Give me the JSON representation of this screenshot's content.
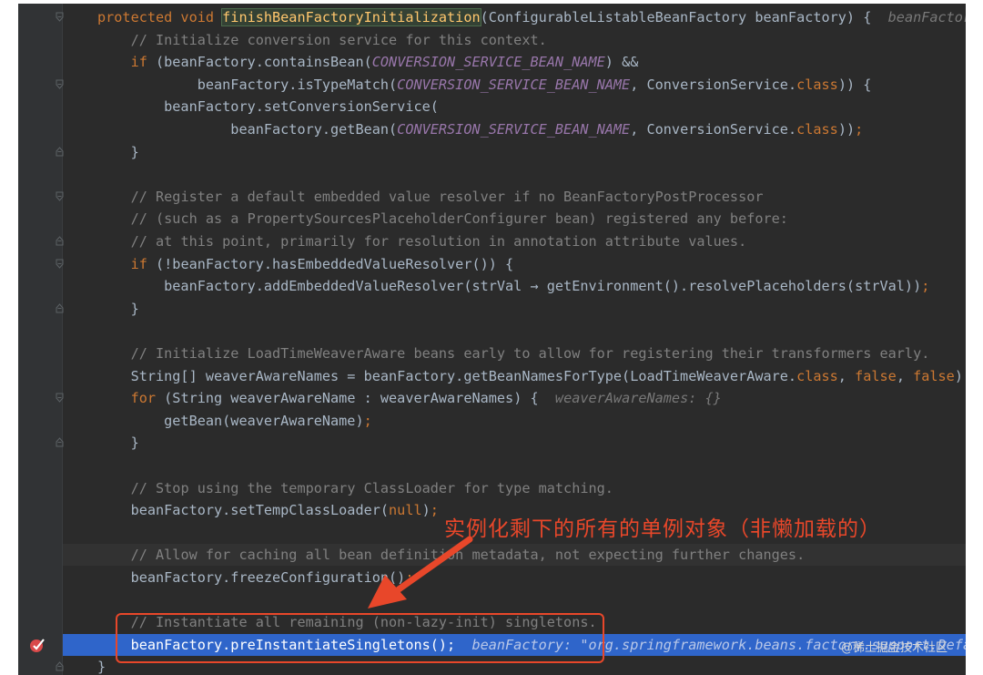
{
  "editor": {
    "lines": [
      {
        "id": "l1",
        "fold": "open",
        "tokens": [
          {
            "t": "protected void ",
            "c": "kw"
          },
          {
            "t": "finishBeanFactoryInitialization",
            "c": "meth"
          },
          {
            "t": "(ConfigurableListableBeanFactory beanFactory) {  "
          },
          {
            "t": "beanFactory",
            "c": "hint"
          }
        ]
      },
      {
        "id": "l2",
        "tokens": [
          {
            "t": "    "
          },
          {
            "t": "// Initialize conversion service for this context.",
            "c": "cm"
          }
        ]
      },
      {
        "id": "l3",
        "tokens": [
          {
            "t": "    "
          },
          {
            "t": "if ",
            "c": "kw"
          },
          {
            "t": "(beanFactory.containsBean("
          },
          {
            "t": "CONVERSION_SERVICE_BEAN_NAME",
            "c": "cn"
          },
          {
            "t": ") &&"
          }
        ]
      },
      {
        "id": "l4",
        "fold": "open",
        "tokens": [
          {
            "t": "            beanFactory.isTypeMatch("
          },
          {
            "t": "CONVERSION_SERVICE_BEAN_NAME",
            "c": "cn"
          },
          {
            "t": ", "
          },
          {
            "t": "ConversionService."
          },
          {
            "t": "class",
            "c": "kw"
          },
          {
            "t": ")) {"
          }
        ]
      },
      {
        "id": "l5",
        "tokens": [
          {
            "t": "        beanFactory.setConversionService("
          }
        ]
      },
      {
        "id": "l6",
        "tokens": [
          {
            "t": "                beanFactory.getBean("
          },
          {
            "t": "CONVERSION_SERVICE_BEAN_NAME",
            "c": "cn"
          },
          {
            "t": ", "
          },
          {
            "t": "ConversionService."
          },
          {
            "t": "class",
            "c": "kw"
          },
          {
            "t": "))"
          },
          {
            "t": ";",
            "c": "kw"
          }
        ]
      },
      {
        "id": "l7",
        "fold": "close",
        "tokens": [
          {
            "t": "    }"
          }
        ]
      },
      {
        "id": "l8",
        "tokens": []
      },
      {
        "id": "l9",
        "fold": "open",
        "tokens": [
          {
            "t": "    "
          },
          {
            "t": "// Register a default embedded value resolver if no BeanFactoryPostProcessor",
            "c": "cm"
          }
        ]
      },
      {
        "id": "l10",
        "tokens": [
          {
            "t": "    "
          },
          {
            "t": "// (such as a PropertySourcesPlaceholderConfigurer bean) registered any before:",
            "c": "cm"
          }
        ]
      },
      {
        "id": "l11",
        "fold": "close",
        "tokens": [
          {
            "t": "    "
          },
          {
            "t": "// at this point, primarily for resolution in annotation attribute values.",
            "c": "cm"
          }
        ]
      },
      {
        "id": "l12",
        "fold": "open",
        "tokens": [
          {
            "t": "    "
          },
          {
            "t": "if ",
            "c": "kw"
          },
          {
            "t": "(!beanFactory.hasEmbeddedValueResolver()) {"
          }
        ]
      },
      {
        "id": "l13",
        "tokens": [
          {
            "t": "        beanFactory.addEmbeddedValueResolver(strVal → getEnvironment().resolvePlaceholders(strVal))"
          },
          {
            "t": ";",
            "c": "kw"
          }
        ]
      },
      {
        "id": "l14",
        "fold": "close",
        "tokens": [
          {
            "t": "    }"
          }
        ]
      },
      {
        "id": "l15",
        "tokens": []
      },
      {
        "id": "l16",
        "tokens": [
          {
            "t": "    "
          },
          {
            "t": "// Initialize LoadTimeWeaverAware beans early to allow for registering their transformers early.",
            "c": "cm"
          }
        ]
      },
      {
        "id": "l17",
        "tokens": [
          {
            "t": "    String[] weaverAwareNames = beanFactory.getBeanNamesForType(LoadTimeWeaverAware."
          },
          {
            "t": "class",
            "c": "kw"
          },
          {
            "t": ", "
          },
          {
            "t": "false",
            "c": "kw"
          },
          {
            "t": ", "
          },
          {
            "t": "false",
            "c": "kw"
          },
          {
            "t": ")"
          },
          {
            "t": ";",
            "c": "kw"
          }
        ]
      },
      {
        "id": "l18",
        "fold": "open",
        "tokens": [
          {
            "t": "    "
          },
          {
            "t": "for ",
            "c": "kw"
          },
          {
            "t": "(String weaverAwareName : weaverAwareNames) {  "
          },
          {
            "t": "weaverAwareNames: {}",
            "c": "hint"
          }
        ]
      },
      {
        "id": "l19",
        "tokens": [
          {
            "t": "        getBean(weaverAwareName)"
          },
          {
            "t": ";",
            "c": "kw"
          }
        ]
      },
      {
        "id": "l20",
        "fold": "close",
        "tokens": [
          {
            "t": "    }"
          }
        ]
      },
      {
        "id": "l21",
        "tokens": []
      },
      {
        "id": "l22",
        "tokens": [
          {
            "t": "    "
          },
          {
            "t": "// Stop using the temporary ClassLoader for type matching.",
            "c": "cm"
          }
        ]
      },
      {
        "id": "l23",
        "tokens": [
          {
            "t": "    beanFactory.setTempClassLoader("
          },
          {
            "t": "null",
            "c": "kw"
          },
          {
            "t": ")"
          },
          {
            "t": ";",
            "c": "kw"
          }
        ]
      },
      {
        "id": "l24",
        "tokens": []
      },
      {
        "id": "l25",
        "bulb": true,
        "hl": true,
        "tokens": [
          {
            "t": "    "
          },
          {
            "t": "// Allow for caching all bean definition metadata, not expecting further changes.",
            "c": "cm"
          }
        ]
      },
      {
        "id": "l26",
        "tokens": [
          {
            "t": "    beanFactory.freezeConfiguration()"
          },
          {
            "t": ";",
            "c": "kw"
          }
        ]
      },
      {
        "id": "l27",
        "tokens": []
      },
      {
        "id": "l28",
        "tokens": [
          {
            "t": "    "
          },
          {
            "t": "// Instantiate all remaining (non-lazy-init) singletons.",
            "c": "cm"
          }
        ]
      },
      {
        "id": "l29",
        "exec": true,
        "breakpoint": true,
        "tokens": [
          {
            "t": "    beanFactory.preInstantiateSingletons();  "
          },
          {
            "t": "beanFactory: \"org.springframework.beans.factory.support.DefaultListableBeanFactory\"",
            "c": "hint"
          }
        ]
      },
      {
        "id": "l30",
        "fold": "close",
        "tokens": [
          {
            "t": "}"
          }
        ]
      }
    ]
  },
  "annotation": {
    "text": "实例化剩下的所有的单例对象（非懒加载的）",
    "color": "#e8472a"
  },
  "watermark": "@稀土掘金技术社区",
  "colors": {
    "background": "#2b2b2b",
    "gutter": "#313335",
    "keyword": "#cc7832",
    "comment": "#808080",
    "constant": "#9876aa",
    "method_decl": "#ffc66d",
    "execution_line": "#2f65ca"
  },
  "icons": {
    "fold_marker": "fold-marker-icon",
    "intention_bulb": "lightbulb-icon",
    "breakpoint": "breakpoint-icon"
  }
}
